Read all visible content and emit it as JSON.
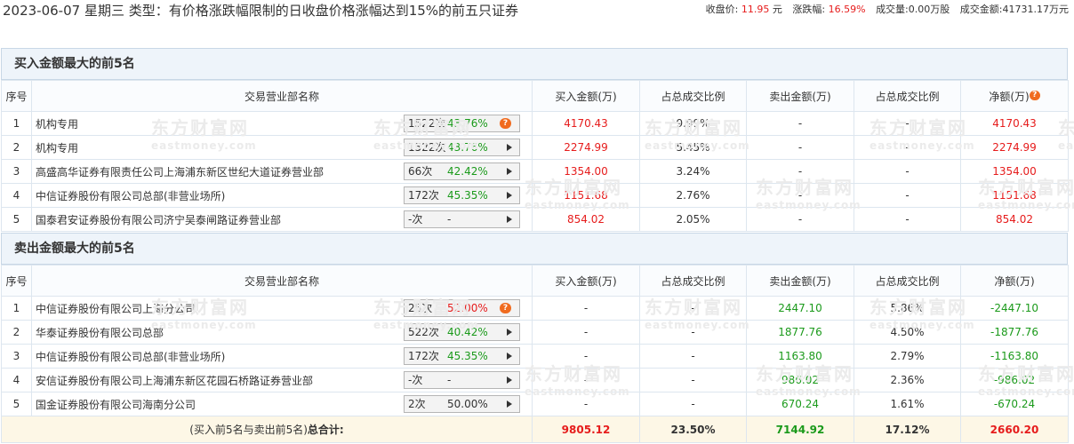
{
  "header": {
    "title": "2023-06-07 星期三 类型：有价格涨跌幅限制的日收盘价格涨幅达到15%的前五只证券",
    "close_label": "收盘价:",
    "close_value": "11.95",
    "close_unit": "元",
    "change_label": "涨跌幅:",
    "change_value": "16.59%",
    "volume_label": "成交量:",
    "volume_value": "0.00万股",
    "amount_label": "成交金额:",
    "amount_value": "41731.17万元"
  },
  "watermark": {
    "cn": "东方财富网",
    "en": "eastmoney.com"
  },
  "columns": {
    "seq": "序号",
    "name": "交易营业部名称",
    "buy": "买入金额(万)",
    "buy_ratio": "占总成交比例",
    "sell": "卖出金额(万)",
    "sell_ratio": "占总成交比例",
    "net": "净额(万)"
  },
  "buy_section": {
    "title": "买入金额最大的前5名",
    "rows": [
      {
        "seq": "1",
        "name": "机构专用",
        "count": "1522次",
        "pct": "43.76%",
        "pct_color": "green",
        "icon": "question-bubble",
        "buy": "4170.43",
        "buy_ratio": "9.99%",
        "sell": "-",
        "sell_ratio": "-",
        "net": "4170.43"
      },
      {
        "seq": "2",
        "name": "机构专用",
        "count": "1522次",
        "pct": "43.76%",
        "pct_color": "green",
        "icon": "arrow-right",
        "buy": "2274.99",
        "buy_ratio": "5.45%",
        "sell": "-",
        "sell_ratio": "-",
        "net": "2274.99"
      },
      {
        "seq": "3",
        "name": "高盛高华证券有限责任公司上海浦东新区世纪大道证券营业部",
        "count": "66次",
        "pct": "42.42%",
        "pct_color": "green",
        "icon": "arrow-right",
        "buy": "1354.00",
        "buy_ratio": "3.24%",
        "sell": "-",
        "sell_ratio": "-",
        "net": "1354.00"
      },
      {
        "seq": "4",
        "name": "中信证券股份有限公司总部(非营业场所)",
        "count": "172次",
        "pct": "45.35%",
        "pct_color": "green",
        "icon": "arrow-right",
        "buy": "1151.68",
        "buy_ratio": "2.76%",
        "sell": "-",
        "sell_ratio": "-",
        "net": "1151.68"
      },
      {
        "seq": "5",
        "name": "国泰君安证券股份有限公司济宁吴泰闸路证券营业部",
        "count": "-次",
        "pct": "-",
        "pct_color": "dark",
        "icon": "arrow-right",
        "buy": "854.02",
        "buy_ratio": "2.05%",
        "sell": "-",
        "sell_ratio": "-",
        "net": "854.02"
      }
    ]
  },
  "sell_section": {
    "title": "卖出金额最大的前5名",
    "rows": [
      {
        "seq": "1",
        "name": "中信证券股份有限公司上海分公司",
        "count": "25次",
        "pct": "52.00%",
        "pct_color": "red",
        "icon": "question-bubble",
        "buy": "-",
        "buy_ratio": "-",
        "sell": "2447.10",
        "sell_ratio": "5.86%",
        "net": "-2447.10"
      },
      {
        "seq": "2",
        "name": "华泰证券股份有限公司总部",
        "count": "522次",
        "pct": "40.42%",
        "pct_color": "green",
        "icon": "arrow-right",
        "buy": "-",
        "buy_ratio": "-",
        "sell": "1877.76",
        "sell_ratio": "4.50%",
        "net": "-1877.76"
      },
      {
        "seq": "3",
        "name": "中信证券股份有限公司总部(非营业场所)",
        "count": "172次",
        "pct": "45.35%",
        "pct_color": "green",
        "icon": "arrow-right",
        "buy": "-",
        "buy_ratio": "-",
        "sell": "1163.80",
        "sell_ratio": "2.79%",
        "net": "-1163.80"
      },
      {
        "seq": "4",
        "name": "安信证券股份有限公司上海浦东新区花园石桥路证券营业部",
        "count": "-次",
        "pct": "-",
        "pct_color": "dark",
        "icon": "arrow-right",
        "buy": "-",
        "buy_ratio": "-",
        "sell": "986.02",
        "sell_ratio": "2.36%",
        "net": "-986.02"
      },
      {
        "seq": "5",
        "name": "国金证券股份有限公司海南分公司",
        "count": "2次",
        "pct": "50.00%",
        "pct_color": "dark",
        "icon": "arrow-right",
        "buy": "-",
        "buy_ratio": "-",
        "sell": "670.24",
        "sell_ratio": "1.61%",
        "net": "-670.24"
      }
    ]
  },
  "total": {
    "label_prefix": "(买入前5名与卖出前5名)",
    "label_bold": "总合计:",
    "buy": "9805.12",
    "buy_ratio": "23.50%",
    "sell": "7144.92",
    "sell_ratio": "17.12%",
    "net": "2660.20"
  },
  "colors": {
    "red": "#e61c1c",
    "green": "#1b9a1b",
    "header_bg": "#eef4fa",
    "total_bg": "#fdf7e6",
    "icon_orange": "#f06b1f"
  }
}
